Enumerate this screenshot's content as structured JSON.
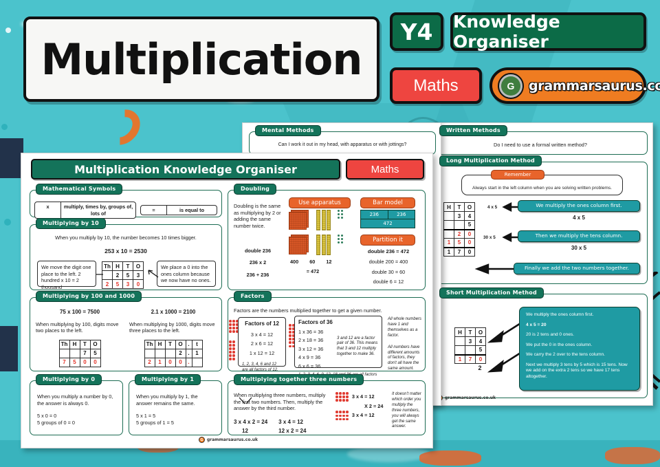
{
  "header": {
    "title": "Multiplication",
    "year_badge": "Y4",
    "doc_type": "Knowledge Organiser",
    "subject": "Maths",
    "brand": "grammarsaurus.co.uk",
    "brand_initial": "G"
  },
  "colors": {
    "background_teal": "#4bc3cc",
    "green_dark": "#0c6b47",
    "panel_green": "#14735a",
    "red": "#ee4540",
    "orange": "#ef7c21",
    "accent_orange": "#e8642b",
    "accent_teal": "#1f9ba3",
    "digit_red": "#e33127"
  },
  "left_sheet": {
    "title": "Multiplication Knowledge Organiser",
    "subject_badge": "Maths",
    "footer_brand": "grammarsaurus.co.uk",
    "symbols": {
      "tab": "Mathematical Symbols",
      "rows": [
        {
          "symbol": "x",
          "meaning": "multiply, times by, groups of, lots of"
        },
        {
          "symbol": "=",
          "meaning": "is equal to"
        }
      ]
    },
    "by_ten": {
      "tab": "Multiplying by 10",
      "intro": "When you multiply by 10, the number becomes 10 times bigger.",
      "equation": "253 x 10 = 2530",
      "left_note": "We move the digit one place to the left. 2 hundred x 10 = 2 thousand",
      "right_note": "We place a 0 into the ones column because we now have no ones.",
      "table": {
        "headers": [
          "Th",
          "H",
          "T",
          "O"
        ],
        "row1": [
          "",
          "2",
          "5",
          "3"
        ],
        "row2": [
          "2",
          "5",
          "3",
          "0"
        ]
      }
    },
    "by_hundred": {
      "tab": "Multiplying by 100 and 1000",
      "left": {
        "equation": "75 x 100 = 7500",
        "note": "When multiplying by 100, digits move two places to the left.",
        "table": {
          "headers": [
            "Th",
            "H",
            "T",
            "O"
          ],
          "row1": [
            "",
            "",
            "7",
            "5"
          ],
          "row2": [
            "7",
            "5",
            "0",
            "0"
          ]
        }
      },
      "right": {
        "equation": "2.1 x 1000 = 2100",
        "note": "When multiplying by 1000, digits move three places to the left.",
        "table": {
          "headers": [
            "Th",
            "H",
            "T",
            "O",
            ".",
            "t"
          ],
          "row1": [
            "",
            "",
            "",
            "2",
            ".",
            "1"
          ],
          "row2": [
            "2",
            "1",
            "0",
            "0",
            ".",
            ""
          ]
        }
      }
    },
    "by_zero": {
      "tab": "Multiplying by 0",
      "note": "When you multiply a  number by 0, the answer is always 0.",
      "lines": [
        "5 x 0 = 0",
        "5 groups of 0 = 0"
      ]
    },
    "by_one": {
      "tab": "Multiplying by 1",
      "note": "When you multiply by 1, the answer remains the same.",
      "lines": [
        "5 x 1 = 5",
        "5 groups of 1 = 5"
      ]
    },
    "doubling": {
      "tab": "Doubling",
      "definition": "Doubling is the same as multiplying by 2 or adding the same number twice.",
      "lines": [
        "double 236",
        "236 x 2",
        "236 + 236"
      ],
      "apparatus_label": "Use apparatus",
      "apparatus_values": [
        "400",
        "60",
        "12"
      ],
      "apparatus_total": "= 472",
      "bar_model_label": "Bar model",
      "bar_top": [
        "236",
        "236"
      ],
      "bar_bottom": "472",
      "partition_label": "Partition it",
      "partition_lines": [
        "double 236 = 472",
        "double 200 = 400",
        "double 30 = 60",
        "double 6 = 12"
      ]
    },
    "factors": {
      "tab": "Factors",
      "intro": "Factors are the numbers multiplied together to get a given number.",
      "box1_title": "Factors of 12",
      "box1_lines": [
        "3 x 4 = 12",
        "2 x 6 = 12",
        "1 x 12 = 12"
      ],
      "box1_note": "1, 2, 3, 4, 6 and 12 are all factors of 12.",
      "box2_title": "Factors of 36",
      "box2_lines": [
        "1 x 36 = 36",
        "2 x 18 = 36",
        "3 x 12 = 36",
        "4 x 9 = 36",
        "6 x 6 = 36"
      ],
      "box2_side_note": "3 and 12 are a factor pair of 36. This means that 3 and 12 multiply together to make 36.",
      "box2_note": "1, 2, 3, 4, 6, 9, 12, 18 and 36 are all factors of 36.",
      "side_note_1": "All whole numbers have 1 and themselves as a factor.",
      "side_note_2": "All numbers have different amounts of factors, they don't all have the same amount."
    },
    "three_numbers": {
      "tab": "Multiplying together three numbers",
      "note": "When multiplying three numbers, multiply the first two numbers. Then, multiply the answer by the third number.",
      "main_equation": "3 x 4 x 2 = 24",
      "sub_result": "12",
      "steps": [
        "3 x 4 = 12",
        "12 x 2 = 24"
      ],
      "array_labels": [
        "3 x 4 = 12",
        "X 2 = 24",
        "3 x 4 = 12"
      ],
      "side_note": "It doesn't matter which order you multiply the three numbers, you will always get the same answer."
    }
  },
  "right_sheets": {
    "mental": {
      "tab": "Mental Methods",
      "question": "Can I work it out in my head, with apparatus or with jottings?"
    },
    "written": {
      "tab": "Written Methods",
      "question": "Do I need to use a formal  written method?"
    },
    "long_method": {
      "tab": "Long Multiplication Method",
      "remember_label": "Remember",
      "remember_text": "Always start in the left column when you are solving written problems.",
      "table": {
        "headers": [
          "H",
          "T",
          "O"
        ],
        "rows": [
          {
            "cells": [
              "",
              "3",
              "4"
            ],
            "red": [
              false,
              false,
              false
            ],
            "line": false
          },
          {
            "cells": [
              "",
              "",
              "5"
            ],
            "red": [
              false,
              false,
              false
            ],
            "line": false
          },
          {
            "cells": [
              "",
              "2",
              "0"
            ],
            "red": [
              false,
              true,
              true
            ],
            "line": true
          },
          {
            "cells": [
              "1",
              "5",
              "0"
            ],
            "red": [
              true,
              true,
              true
            ],
            "line": false
          },
          {
            "cells": [
              "1",
              "7",
              "0"
            ],
            "red": [
              false,
              false,
              false
            ],
            "line": true
          }
        ]
      },
      "small_labels": [
        "4 x 5",
        "30 x 5"
      ],
      "callouts": [
        "We multiply the ones column first.",
        "Then we multiply the tens column.",
        "Finally we add the two numbers together."
      ],
      "big_labels": [
        "4 x 5",
        "30 x 5"
      ]
    },
    "short_method": {
      "tab": "Short Multiplication Method",
      "table": {
        "headers": [
          "H",
          "T",
          "O"
        ],
        "rows": [
          {
            "cells": [
              "",
              "3",
              "4"
            ],
            "red": [
              false,
              false,
              false
            ],
            "line": false
          },
          {
            "cells": [
              "",
              "",
              "5"
            ],
            "red": [
              false,
              false,
              false
            ],
            "line": false
          },
          {
            "cells": [
              "1",
              "7",
              "0"
            ],
            "red": [
              true,
              true,
              true
            ],
            "line": true
          }
        ]
      },
      "carry": "2",
      "explanation": [
        "We multiply the ones column first.",
        "4 x 5 = 20",
        "20 is 2 tens and 0 ones.",
        "We put the 0 in the ones column.",
        "We carry the 2 over to the tens column.",
        "Next we multiply 3 tens by 5 which is 15 tens. Now we add on the extra 2 tens so we have 17 tens altogether."
      ]
    },
    "footer_brand": "grammarsaurus.co.uk"
  }
}
